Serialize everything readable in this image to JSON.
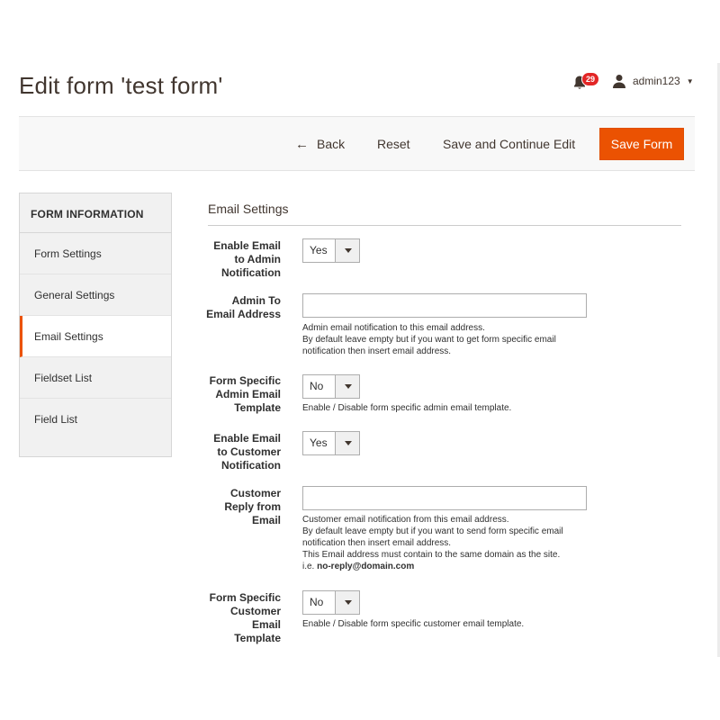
{
  "header": {
    "title": "Edit form 'test form'",
    "notifications_count": "29",
    "username": "admin123"
  },
  "toolbar": {
    "back_label": "Back",
    "reset_label": "Reset",
    "save_continue_label": "Save and Continue Edit",
    "save_form_label": "Save Form"
  },
  "sidebar": {
    "heading": "FORM INFORMATION",
    "items": [
      {
        "label": "Form Settings",
        "active": false
      },
      {
        "label": "General Settings",
        "active": false
      },
      {
        "label": "Email Settings",
        "active": true
      },
      {
        "label": "Fieldset List",
        "active": false
      },
      {
        "label": "Field List",
        "active": false
      }
    ]
  },
  "section": {
    "title": "Email Settings",
    "fields": {
      "enable_admin": {
        "label_lines": [
          "Enable Email",
          "to Admin",
          "Notification"
        ],
        "value": "Yes"
      },
      "admin_email": {
        "label_lines": [
          "Admin To",
          "Email Address"
        ],
        "value": "",
        "note_lines": [
          "Admin email notification to this email address.",
          "By default leave empty but if you want to get form specific email",
          "notification then insert email address."
        ]
      },
      "admin_template": {
        "label_lines": [
          "Form Specific",
          "Admin Email",
          "Template"
        ],
        "value": "No",
        "note": "Enable / Disable form specific admin email template."
      },
      "enable_customer": {
        "label_lines": [
          "Enable Email",
          "to Customer",
          "Notification"
        ],
        "value": "Yes"
      },
      "customer_reply": {
        "label_lines": [
          "Customer",
          "Reply from",
          "Email"
        ],
        "value": "",
        "note_lines": [
          "Customer email notification from this email address.",
          "By default leave empty but if you want to send form specific email",
          "notification then insert email address.",
          "This Email address must contain to the same domain as the site."
        ],
        "note_example_prefix": "i.e. ",
        "note_example_value": "no-reply@domain.com"
      },
      "customer_template": {
        "label_lines": [
          "Form Specific",
          "Customer",
          "Email",
          "Template"
        ],
        "value": "No",
        "note": "Enable / Disable form specific customer email template."
      }
    }
  },
  "colors": {
    "accent": "#eb5202",
    "badge": "#e22626"
  }
}
